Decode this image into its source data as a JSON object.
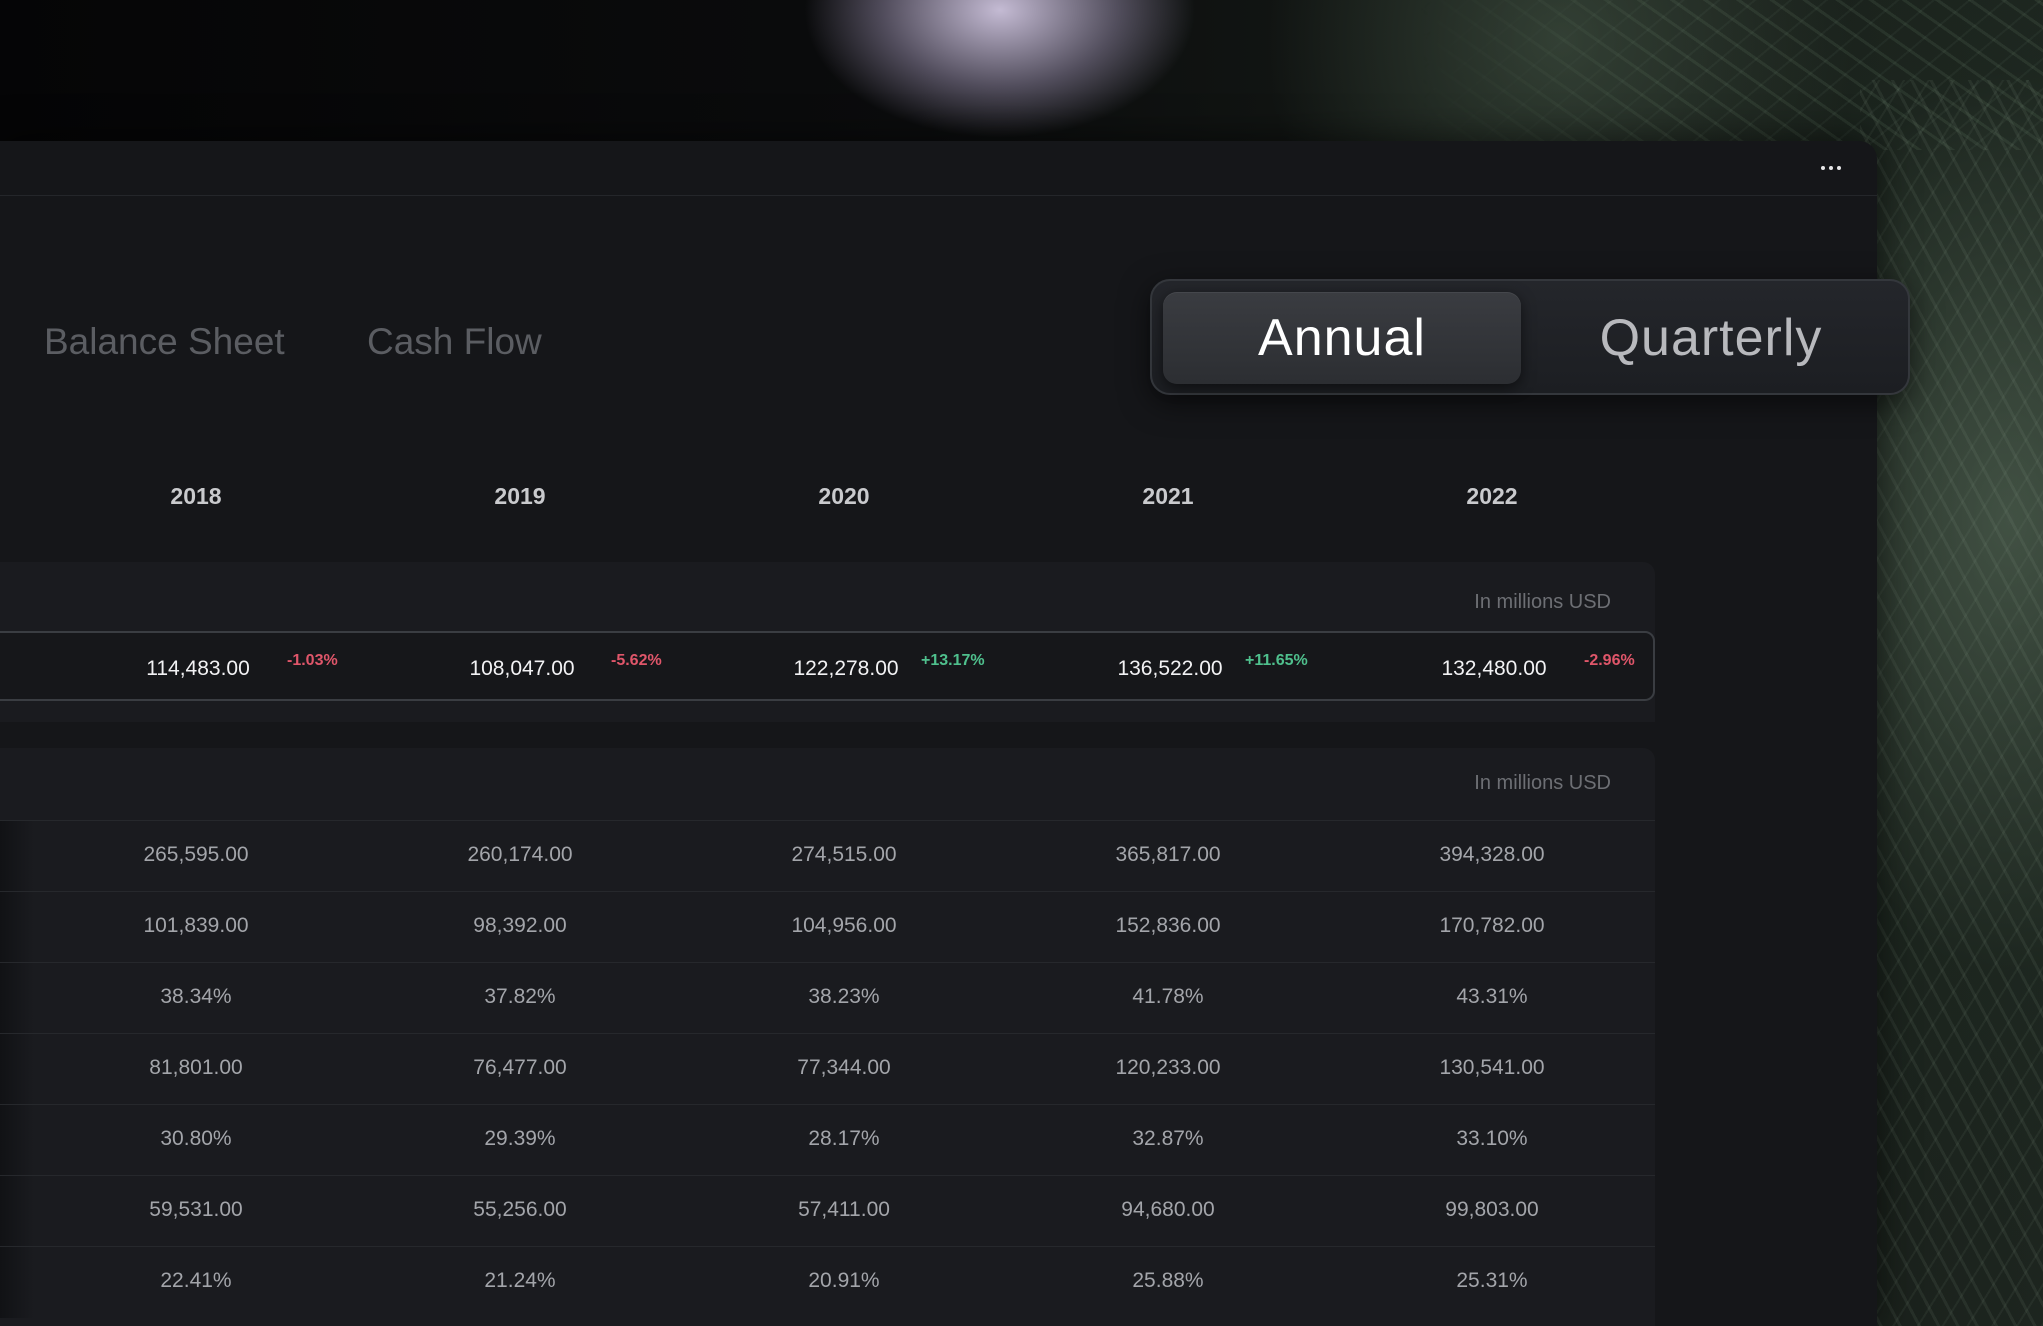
{
  "window": {
    "more_icon": "more-horizontal-icon"
  },
  "tabs": [
    {
      "label": "Balance Sheet"
    },
    {
      "label": "Cash Flow"
    }
  ],
  "period": {
    "options": [
      "Annual",
      "Quarterly"
    ],
    "selected": "Annual"
  },
  "years": [
    "2018",
    "2019",
    "2020",
    "2021",
    "2022"
  ],
  "sections": [
    {
      "units": "In millions USD",
      "highlight": {
        "values": [
          "114,483.00",
          "108,047.00",
          "122,278.00",
          "136,522.00",
          "132,480.00"
        ],
        "changes": [
          {
            "text": "-1.03%",
            "direction": "down"
          },
          {
            "text": "-5.62%",
            "direction": "down"
          },
          {
            "text": "+13.17%",
            "direction": "up"
          },
          {
            "text": "+11.65%",
            "direction": "up"
          },
          {
            "text": "-2.96%",
            "direction": "down"
          }
        ]
      }
    },
    {
      "units": "In millions USD",
      "rows": [
        [
          "265,595.00",
          "260,174.00",
          "274,515.00",
          "365,817.00",
          "394,328.00"
        ],
        [
          "101,839.00",
          "98,392.00",
          "104,956.00",
          "152,836.00",
          "170,782.00"
        ],
        [
          "38.34%",
          "37.82%",
          "38.23%",
          "41.78%",
          "43.31%"
        ],
        [
          "81,801.00",
          "76,477.00",
          "77,344.00",
          "120,233.00",
          "130,541.00"
        ],
        [
          "30.80%",
          "29.39%",
          "28.17%",
          "32.87%",
          "33.10%"
        ],
        [
          "59,531.00",
          "55,256.00",
          "57,411.00",
          "94,680.00",
          "99,803.00"
        ],
        [
          "22.41%",
          "21.24%",
          "20.91%",
          "25.88%",
          "25.31%"
        ]
      ]
    }
  ],
  "colors": {
    "negative": "#e0566a",
    "positive": "#4fc08d",
    "background": "#151619"
  }
}
